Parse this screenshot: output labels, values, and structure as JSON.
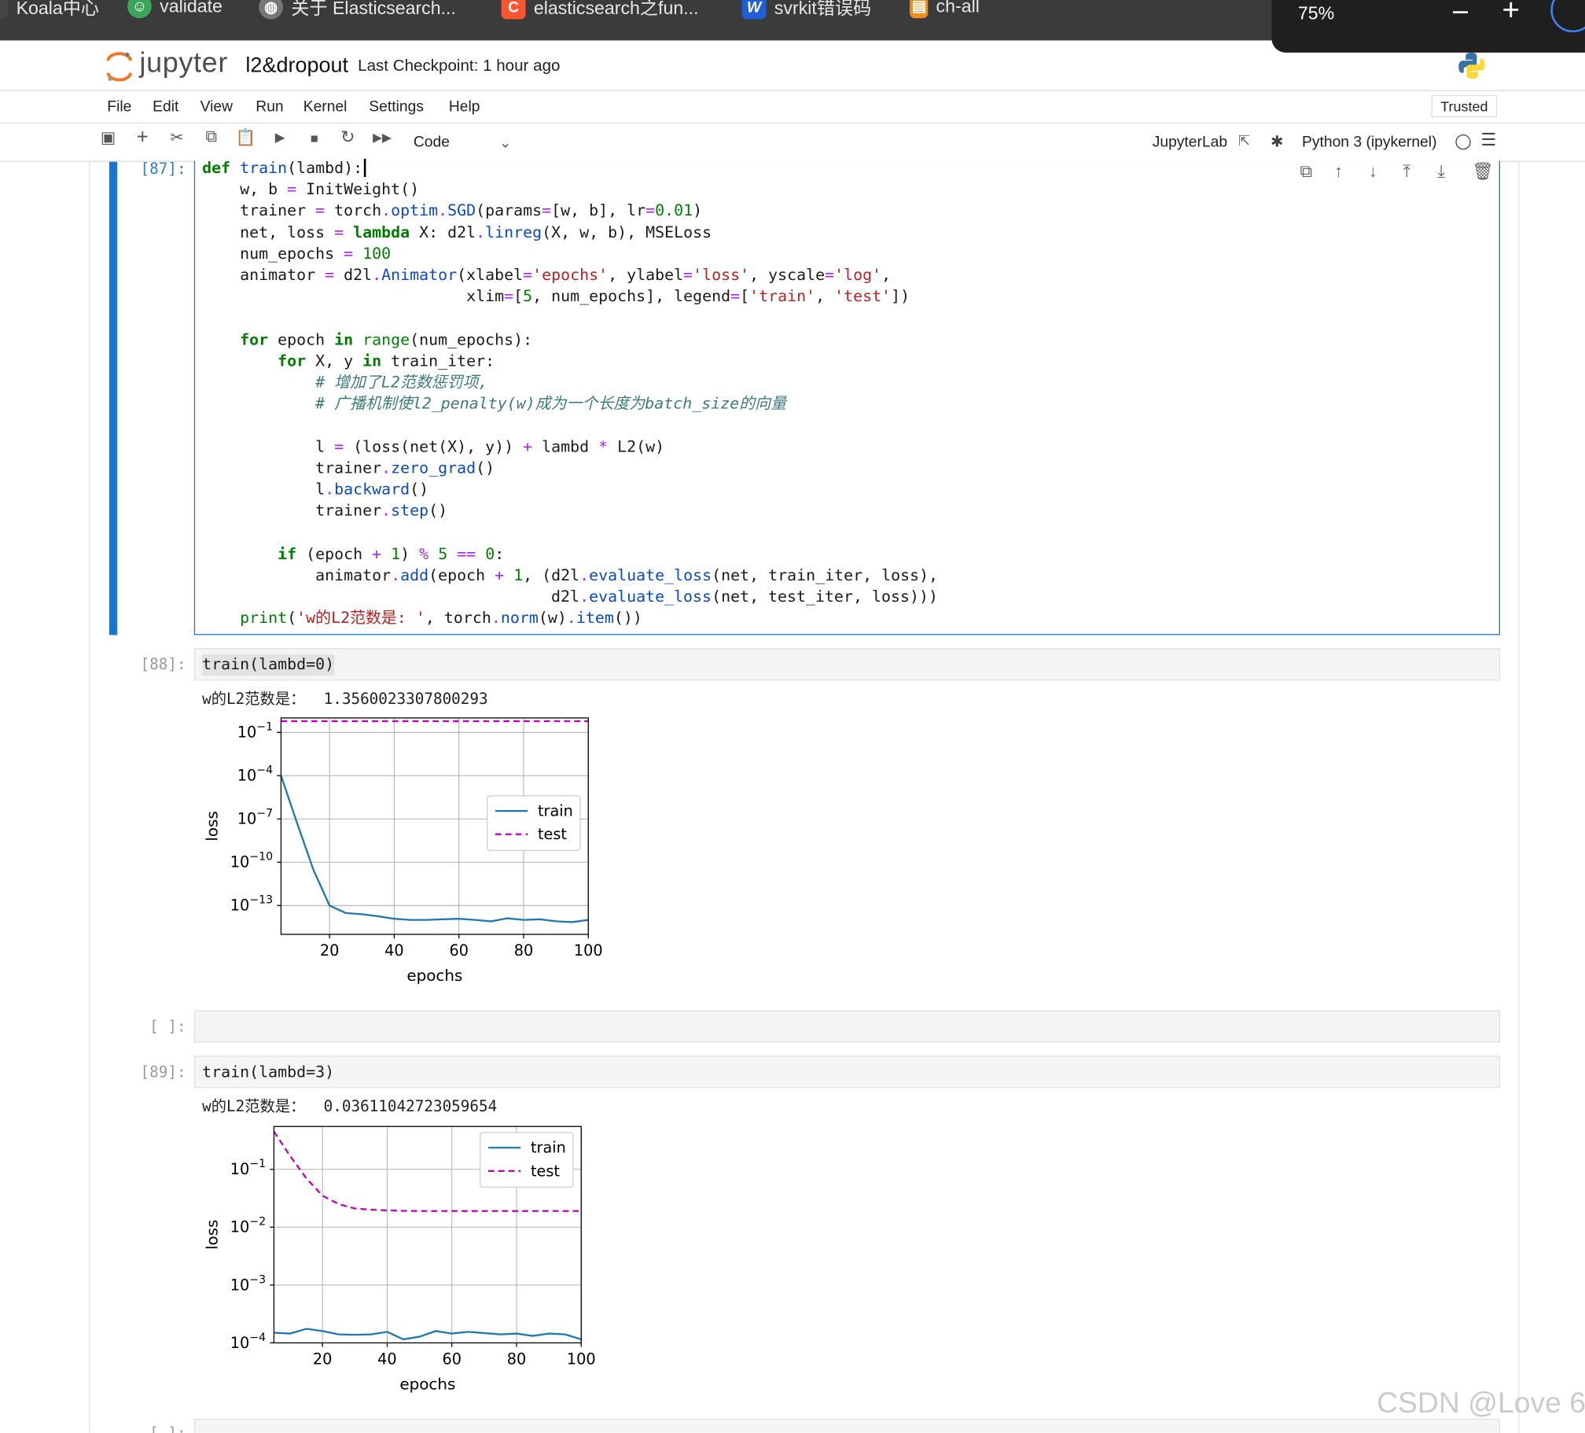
{
  "bookmarks": [
    {
      "label": "Koala中心",
      "icon": "koala-icon",
      "color": "#444444"
    },
    {
      "label": "validate",
      "icon": "discord-icon",
      "color": "#3ba55c"
    },
    {
      "label": "关于 Elasticsearch...",
      "icon": "globe-icon",
      "color": "#777777"
    },
    {
      "label": "elasticsearch之fun...",
      "icon": "csdn-c-icon",
      "color": "#fc5531"
    },
    {
      "label": "svrkit错误码",
      "icon": "word-w-icon",
      "color": "#1f5fd6"
    },
    {
      "label": "ch-all",
      "icon": "notebook-icon",
      "color": "#f08c1a"
    }
  ],
  "zoom": {
    "value": "75%",
    "minus": "−",
    "plus": "+"
  },
  "header": {
    "logo_text": "jupyter",
    "notebook_name": "l2&dropout",
    "checkpoint": "Last Checkpoint: 1 hour ago",
    "kernel_logo": "python-logo-icon"
  },
  "menu": {
    "items": [
      "File",
      "Edit",
      "View",
      "Run",
      "Kernel",
      "Settings",
      "Help"
    ],
    "trusted": "Trusted"
  },
  "toolbar": {
    "cell_type": "Code",
    "jupyterlab": "JupyterLab",
    "kernel": "Python 3 (ipykernel)"
  },
  "cells": {
    "c87": {
      "prompt": "[87]:"
    },
    "c88": {
      "prompt": "[88]:",
      "code": "train(lambd=0)",
      "output": "w的L2范数是：  1.3560023307800293"
    },
    "cE": {
      "prompt": "[ ]:"
    },
    "c89": {
      "prompt": "[89]:",
      "code": "train(lambd=3)",
      "output": "w的L2范数是：  0.03611042723059654"
    },
    "cE2": {
      "prompt": "[ ]:"
    }
  },
  "watermark": "CSDN @Love 6",
  "chart_data": [
    {
      "type": "line",
      "xlabel": "epochs",
      "ylabel": "loss",
      "yscale": "log",
      "xlim": [
        5,
        100
      ],
      "ylim": [
        1e-15,
        1
      ],
      "x": [
        5,
        10,
        15,
        20,
        25,
        30,
        35,
        40,
        45,
        50,
        55,
        60,
        65,
        70,
        75,
        80,
        85,
        90,
        95,
        100
      ],
      "yticks": [
        {
          "e": -1
        },
        {
          "e": -4
        },
        {
          "e": -7
        },
        {
          "e": -10
        },
        {
          "e": -13
        }
      ],
      "xticks": [
        20,
        40,
        60,
        80,
        100
      ],
      "legend": "center-right",
      "series": [
        {
          "name": "train",
          "color": "#1f77b4",
          "dash": false,
          "values": [
            0.0001,
            5e-08,
            3e-11,
            1e-13,
            3e-14,
            2.5e-14,
            1.8e-14,
            1.2e-14,
            1e-14,
            1e-14,
            1.1e-14,
            1.2e-14,
            1e-14,
            8e-15,
            1.3e-14,
            1e-14,
            1.1e-14,
            8e-15,
            7e-15,
            1e-14
          ]
        },
        {
          "name": "test",
          "color": "#bf00bf",
          "dash": true,
          "values": [
            0.6,
            0.6,
            0.6,
            0.6,
            0.6,
            0.6,
            0.6,
            0.6,
            0.6,
            0.6,
            0.6,
            0.6,
            0.6,
            0.6,
            0.6,
            0.6,
            0.6,
            0.6,
            0.6,
            0.6
          ]
        }
      ]
    },
    {
      "type": "line",
      "xlabel": "epochs",
      "ylabel": "loss",
      "yscale": "log",
      "xlim": [
        5,
        100
      ],
      "ylim": [
        0.0001,
        0.55
      ],
      "x": [
        5,
        10,
        15,
        20,
        25,
        30,
        35,
        40,
        45,
        50,
        55,
        60,
        65,
        70,
        75,
        80,
        85,
        90,
        95,
        100
      ],
      "yticks": [
        {
          "e": -1
        },
        {
          "e": -2
        },
        {
          "e": -3
        },
        {
          "e": -4
        }
      ],
      "xticks": [
        20,
        40,
        60,
        80,
        100
      ],
      "legend": "upper-right",
      "series": [
        {
          "name": "train",
          "color": "#1f77b4",
          "dash": false,
          "values": [
            0.00015,
            0.000145,
            0.000175,
            0.00016,
            0.00014,
            0.000138,
            0.00014,
            0.000155,
            0.000115,
            0.000128,
            0.00016,
            0.000145,
            0.000155,
            0.000148,
            0.00014,
            0.000145,
            0.000132,
            0.000145,
            0.00014,
            0.000115
          ]
        },
        {
          "name": "test",
          "color": "#bf00bf",
          "dash": true,
          "values": [
            0.45,
            0.17,
            0.07,
            0.035,
            0.025,
            0.021,
            0.02,
            0.0195,
            0.0192,
            0.019,
            0.019,
            0.019,
            0.019,
            0.019,
            0.019,
            0.019,
            0.019,
            0.019,
            0.019,
            0.019
          ]
        }
      ]
    }
  ]
}
